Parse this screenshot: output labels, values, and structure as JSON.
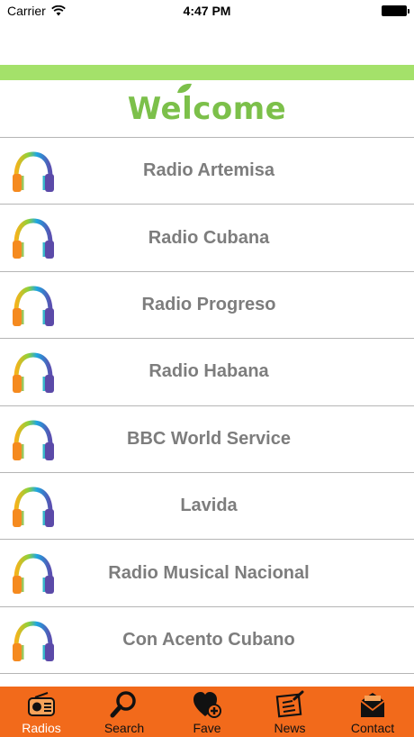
{
  "status_bar": {
    "carrier": "Carrier",
    "time": "4:47 PM"
  },
  "header": {
    "welcome": "Welcome"
  },
  "colors": {
    "accent_green": "#a4e16a",
    "welcome_green": "#7cc04a",
    "tab_bar": "#f26a1b",
    "item_text": "#7d7d7d"
  },
  "stations": [
    {
      "name": "Radio Artemisa",
      "icon": "headphones-icon"
    },
    {
      "name": "Radio Cubana",
      "icon": "headphones-icon"
    },
    {
      "name": "Radio Progreso",
      "icon": "headphones-icon"
    },
    {
      "name": "Radio Habana",
      "icon": "headphones-icon"
    },
    {
      "name": "BBC World Service",
      "icon": "headphones-icon"
    },
    {
      "name": "Lavida",
      "icon": "headphones-icon"
    },
    {
      "name": "Radio Musical Nacional",
      "icon": "headphones-icon"
    },
    {
      "name": "Con Acento Cubano",
      "icon": "headphones-icon"
    }
  ],
  "tabs": [
    {
      "label": "Radios",
      "icon": "radio-icon",
      "active": true
    },
    {
      "label": "Search",
      "icon": "magnifier-icon",
      "active": false
    },
    {
      "label": "Fave",
      "icon": "heart-plus-icon",
      "active": false
    },
    {
      "label": "News",
      "icon": "news-icon",
      "active": false
    },
    {
      "label": "Contact",
      "icon": "envelope-icon",
      "active": false
    }
  ]
}
